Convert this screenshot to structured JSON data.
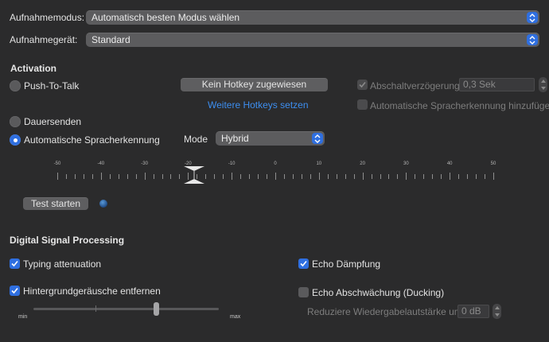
{
  "mode_row": {
    "label": "Aufnahmemodus:",
    "value": "Automatisch besten Modus wählen"
  },
  "device_row": {
    "label": "Aufnahmegerät:",
    "value": "Standard"
  },
  "activation": {
    "title": "Activation",
    "push_to_talk": {
      "label": "Push-To-Talk",
      "selected": false
    },
    "hotkey_button": "Kein Hotkey zugewiesen",
    "more_hotkeys_link": "Weitere Hotkeys setzen",
    "release_delay": {
      "label": "Abschaltverzögerung:",
      "value": "0,3 Sek",
      "checked": true,
      "enabled": false
    },
    "auto_speech_add": {
      "label": "Automatische Spracherkennung hinzufügen",
      "checked": false,
      "enabled": false
    },
    "continuous": {
      "label": "Dauersenden",
      "selected": false
    },
    "auto_speech": {
      "label": "Automatische Spracherkennung",
      "selected": true
    },
    "mode": {
      "label": "Mode",
      "value": "Hybrid"
    },
    "scale_labels": [
      "-50",
      "-40",
      "-30",
      "-20",
      "-10",
      "0",
      "10",
      "20",
      "30",
      "40",
      "50"
    ],
    "threshold_value": -20,
    "test_button": "Test starten"
  },
  "dsp": {
    "title": "Digital Signal Processing",
    "typing_attenuation": {
      "label": "Typing attenuation",
      "checked": true
    },
    "noise_removal": {
      "label": "Hintergrundgeräusche entfernen",
      "checked": true
    },
    "noise_slider": {
      "min_label": "min",
      "max_label": "max",
      "level": 0.66
    },
    "echo_damping": {
      "label": "Echo Dämpfung",
      "checked": true
    },
    "echo_ducking": {
      "label": "Echo Abschwächung (Ducking)",
      "checked": false
    },
    "reduce_playback": {
      "label": "Reduziere Wiedergabelautstärke um:",
      "value": "0 dB",
      "enabled": false
    }
  },
  "colors": {
    "accent": "#2f6fe0",
    "link": "#3d8ef0",
    "background": "#2b2b2c"
  }
}
